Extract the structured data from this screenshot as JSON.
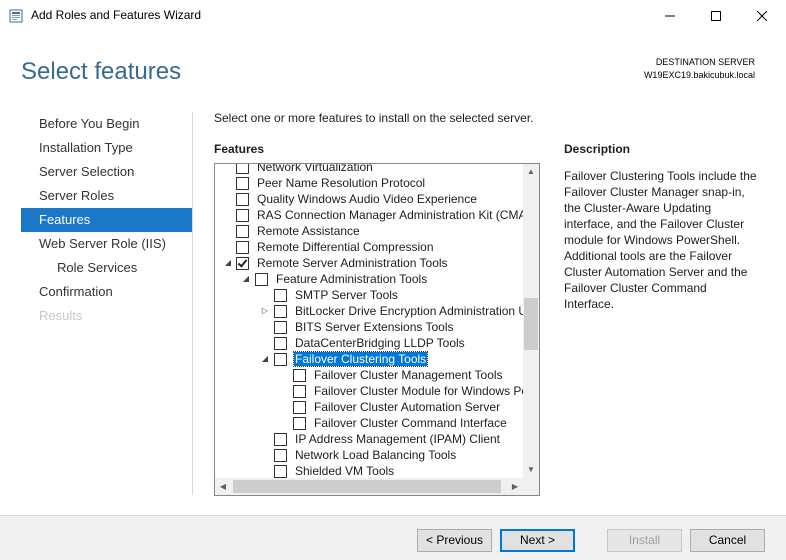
{
  "window": {
    "title": "Add Roles and Features Wizard",
    "icon": "server-manager-icon"
  },
  "header": {
    "title": "Select features",
    "destination_label": "DESTINATION SERVER",
    "destination_server": "W19EXC19.bakicubuk.local"
  },
  "nav": {
    "items": [
      {
        "label": "Before You Begin",
        "state": "normal"
      },
      {
        "label": "Installation Type",
        "state": "normal"
      },
      {
        "label": "Server Selection",
        "state": "normal"
      },
      {
        "label": "Server Roles",
        "state": "normal"
      },
      {
        "label": "Features",
        "state": "active"
      },
      {
        "label": "Web Server Role (IIS)",
        "state": "normal"
      },
      {
        "label": "Role Services",
        "state": "sub"
      },
      {
        "label": "Confirmation",
        "state": "normal"
      },
      {
        "label": "Results",
        "state": "disabled"
      }
    ]
  },
  "main": {
    "instruction": "Select one or more features to install on the selected server.",
    "features_label": "Features",
    "description_label": "Description",
    "description_text": "Failover Clustering Tools include the Failover Cluster Manager snap-in, the Cluster-Aware Updating interface, and the Failover Cluster module for Windows PowerShell. Additional tools are the Failover Cluster Automation Server and the Failover Cluster Command Interface."
  },
  "features_tree": [
    {
      "label": "Network Virtualization",
      "level": 0,
      "expander": "",
      "checked": false,
      "selected": false
    },
    {
      "label": "Peer Name Resolution Protocol",
      "level": 0,
      "expander": "",
      "checked": false,
      "selected": false
    },
    {
      "label": "Quality Windows Audio Video Experience",
      "level": 0,
      "expander": "",
      "checked": false,
      "selected": false
    },
    {
      "label": "RAS Connection Manager Administration Kit (CMAK)",
      "level": 0,
      "expander": "",
      "checked": false,
      "selected": false
    },
    {
      "label": "Remote Assistance",
      "level": 0,
      "expander": "",
      "checked": false,
      "selected": false
    },
    {
      "label": "Remote Differential Compression",
      "level": 0,
      "expander": "",
      "checked": false,
      "selected": false
    },
    {
      "label": "Remote Server Administration Tools",
      "level": 0,
      "expander": "expanded",
      "checked": true,
      "selected": false
    },
    {
      "label": "Feature Administration Tools",
      "level": 1,
      "expander": "expanded",
      "checked": false,
      "selected": false
    },
    {
      "label": "SMTP Server Tools",
      "level": 2,
      "expander": "",
      "checked": false,
      "selected": false
    },
    {
      "label": "BitLocker Drive Encryption Administration Utilities",
      "level": 2,
      "expander": "collapsed",
      "checked": false,
      "selected": false
    },
    {
      "label": "BITS Server Extensions Tools",
      "level": 2,
      "expander": "",
      "checked": false,
      "selected": false
    },
    {
      "label": "DataCenterBridging LLDP Tools",
      "level": 2,
      "expander": "",
      "checked": false,
      "selected": false
    },
    {
      "label": "Failover Clustering Tools",
      "level": 2,
      "expander": "expanded",
      "checked": false,
      "selected": true
    },
    {
      "label": "Failover Cluster Management Tools",
      "level": 3,
      "expander": "",
      "checked": false,
      "selected": false
    },
    {
      "label": "Failover Cluster Module for Windows PowerShell",
      "level": 3,
      "expander": "",
      "checked": false,
      "selected": false
    },
    {
      "label": "Failover Cluster Automation Server",
      "level": 3,
      "expander": "",
      "checked": false,
      "selected": false
    },
    {
      "label": "Failover Cluster Command Interface",
      "level": 3,
      "expander": "",
      "checked": false,
      "selected": false
    },
    {
      "label": "IP Address Management (IPAM) Client",
      "level": 2,
      "expander": "",
      "checked": false,
      "selected": false
    },
    {
      "label": "Network Load Balancing Tools",
      "level": 2,
      "expander": "",
      "checked": false,
      "selected": false
    },
    {
      "label": "Shielded VM Tools",
      "level": 2,
      "expander": "",
      "checked": false,
      "selected": false
    }
  ],
  "footer": {
    "previous": "< Previous",
    "next": "Next >",
    "install": "Install",
    "cancel": "Cancel"
  },
  "colors": {
    "title_accent": "#366a8e",
    "nav_active": "#1a78c6",
    "selection": "#0078d7"
  }
}
